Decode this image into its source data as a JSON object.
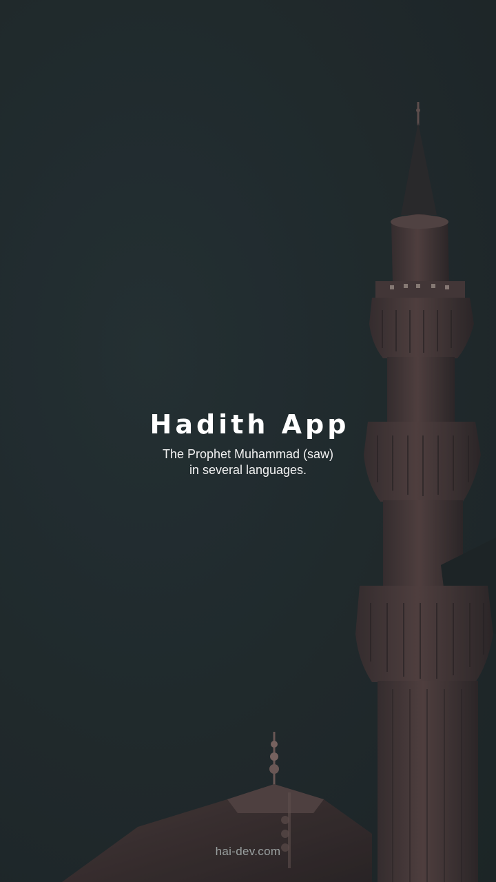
{
  "splash": {
    "title": "Hadith App",
    "subtitle_line1": "The Prophet Muhammad (saw)",
    "subtitle_line2": "in several languages.",
    "footer": "hai-dev.com"
  },
  "background": {
    "description_icon": "minaret-silhouette",
    "colors": {
      "base": "#222c30",
      "stone": "#4a3a3a",
      "text": "#ffffff",
      "footer": "#9aa0a0"
    }
  }
}
